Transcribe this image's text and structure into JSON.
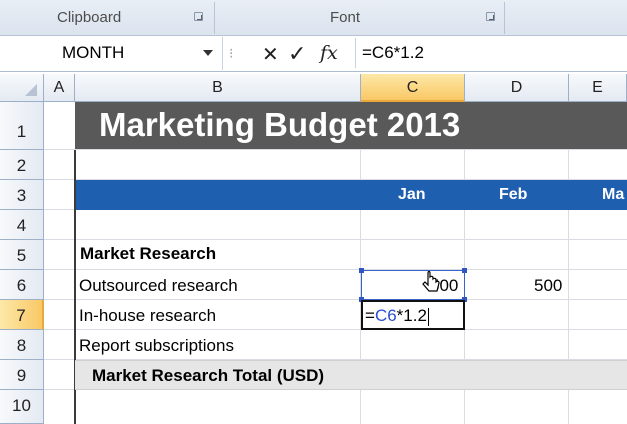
{
  "ribbon": {
    "groups": [
      {
        "label": "Clipboard"
      },
      {
        "label": "Font"
      }
    ]
  },
  "formula_bar": {
    "name_box": "MONTH",
    "cancel_glyph": "✕",
    "enter_glyph": "✓",
    "fx_glyph": "fx",
    "formula": "=C6*1.2"
  },
  "columns": [
    "A",
    "B",
    "C",
    "D",
    "E"
  ],
  "rows": [
    "1",
    "2",
    "3",
    "4",
    "5",
    "6",
    "7",
    "8",
    "9",
    "10"
  ],
  "sheet": {
    "title": "Marketing Budget 2013",
    "months": [
      "Jan",
      "Feb",
      "Ma"
    ],
    "section": "Market Research",
    "items": [
      {
        "label": "Outsourced research",
        "jan": "500",
        "feb": "500"
      },
      {
        "label": "In-house research"
      },
      {
        "label": "Report subscriptions"
      }
    ],
    "total_label": "Market Research Total (USD)",
    "editing": {
      "prefix": "=",
      "ref": "C6",
      "suffix": "*1.2"
    }
  },
  "colors": {
    "title_band": "#595959",
    "month_band": "#1f5fb0",
    "selected_header": "#f9c865",
    "reference_highlight": "#2a4fd1"
  },
  "icons": [
    "dialog-launcher-icon",
    "dropdown-arrow-icon",
    "cancel-icon",
    "enter-icon",
    "function-icon",
    "select-all-icon",
    "move-cursor-icon"
  ]
}
